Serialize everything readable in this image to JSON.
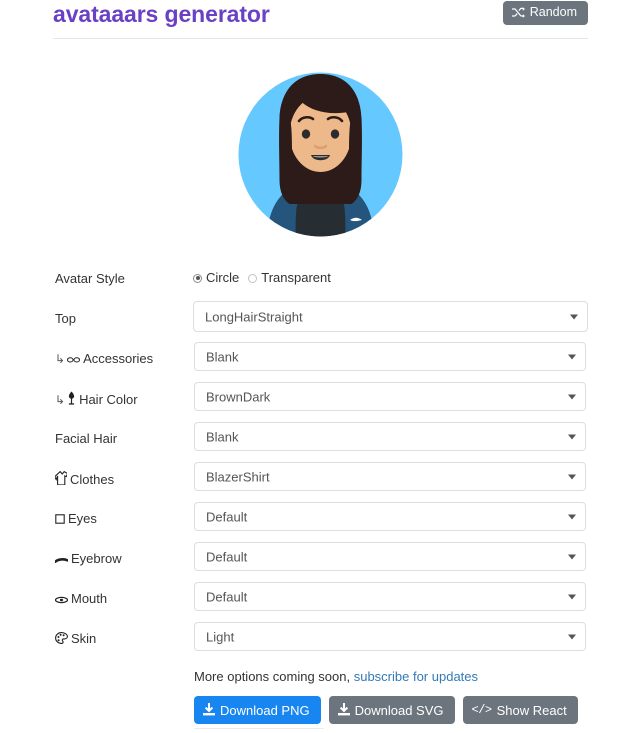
{
  "header": {
    "title": "avataaars generator",
    "random_button": {
      "label": "Random",
      "icon": "shuffle-icon",
      "bg": "#6c757d"
    },
    "title_color": "#6a41c4"
  },
  "avatar": {
    "style": "Circle",
    "circle_bg": "#65c9ff",
    "skin_color": "#edb98a",
    "hair_color": "#2c1b18",
    "clothes_color": "#25557c",
    "shirt_color": "#262e33",
    "mouth": "smile-open",
    "eyes": "default",
    "eyebrow": "default"
  },
  "form": {
    "rows": [
      {
        "label": "Avatar Style",
        "icon": "",
        "sub": false,
        "type": "radio",
        "options": [
          {
            "label": "Circle",
            "selected": true
          },
          {
            "label": "Transparent",
            "selected": false
          }
        ]
      },
      {
        "label": "Top",
        "icon": "",
        "sub": false,
        "type": "select",
        "value": "LongHairStraight",
        "wide": true
      },
      {
        "label": "Accessories",
        "icon": "glasses-icon",
        "sub": true,
        "type": "select",
        "value": "Blank"
      },
      {
        "label": "Hair Color",
        "icon": "hair-color-icon",
        "sub": true,
        "type": "select",
        "value": "BrownDark"
      },
      {
        "label": "Facial Hair",
        "icon": "",
        "sub": false,
        "type": "select",
        "value": "Blank"
      },
      {
        "label": "Clothes",
        "icon": "shirt-icon",
        "sub": false,
        "type": "select",
        "value": "BlazerShirt"
      },
      {
        "label": "Eyes",
        "icon": "eye-icon",
        "sub": false,
        "type": "select",
        "value": "Default"
      },
      {
        "label": "Eyebrow",
        "icon": "eyebrow-icon",
        "sub": false,
        "type": "select",
        "value": "Default"
      },
      {
        "label": "Mouth",
        "icon": "mouth-icon",
        "sub": false,
        "type": "select",
        "value": "Default"
      },
      {
        "label": "Skin",
        "icon": "palette-icon",
        "sub": false,
        "type": "select",
        "value": "Light"
      }
    ]
  },
  "footer": {
    "note_text": "More options coming soon,",
    "note_link": "subscribe for updates",
    "link_color": "#337ab7",
    "buttons": [
      {
        "label": "Download PNG",
        "icon": "download-icon",
        "style": "primary"
      },
      {
        "label": "Download SVG",
        "icon": "download-icon",
        "style": "secondary"
      },
      {
        "label": "Show React",
        "icon": "code-icon",
        "style": "secondary"
      }
    ]
  }
}
